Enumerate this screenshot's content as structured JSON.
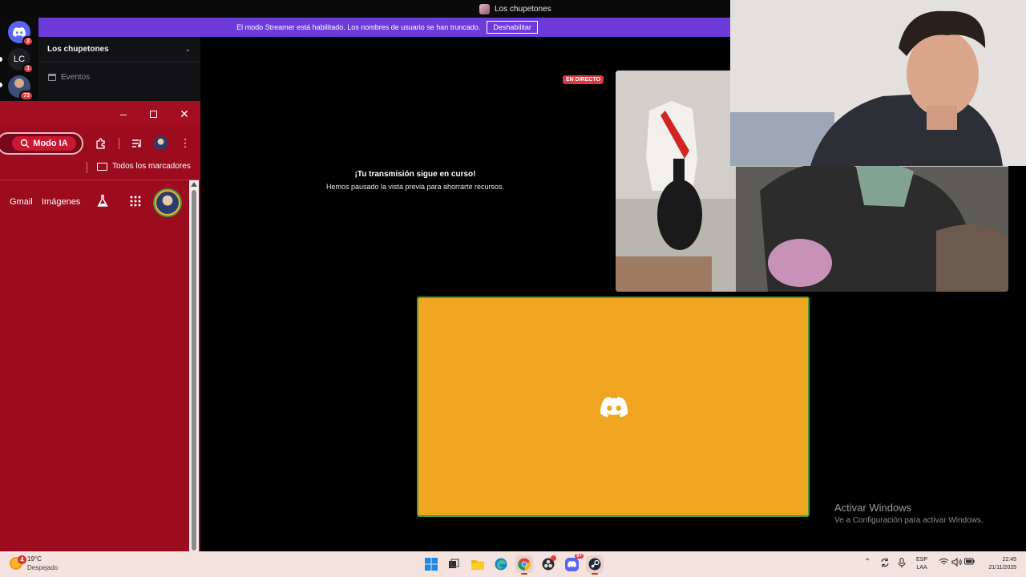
{
  "window": {
    "title": "Los chupetones"
  },
  "banner": {
    "message": "El modo Streamer está habilitado. Los nombres de usuario se han truncado.",
    "button_label": "Deshabilitar"
  },
  "servers": [
    {
      "label": "",
      "badge": "2"
    },
    {
      "label": "LC",
      "badge": "1"
    },
    {
      "label": "",
      "badge": "73"
    }
  ],
  "channel_list": {
    "server_name": "Los chupetones",
    "events_label": "Eventos"
  },
  "chrome": {
    "modo_ia_label": "Modo IA",
    "bookmarks_label": "Todos los marcadores",
    "links": {
      "gmail": "Gmail",
      "images": "Imágenes"
    }
  },
  "stream": {
    "live_badge": "EN DIRECTO",
    "paused_title": "¡Tu transmisión sigue en curso!",
    "paused_subtitle": "Hemos pausado la vista previa para ahorrarte recursos."
  },
  "activate_windows": {
    "title": "Activar Windows",
    "subtitle": "Ve a Configuración para activar Windows."
  },
  "taskbar": {
    "weather": {
      "temp": "19°C",
      "condition": "Despejado",
      "badge": "4"
    },
    "language": {
      "lang": "ESP",
      "layout": "LAA"
    },
    "clock": {
      "time": "22:45",
      "date": "21/11/2025"
    },
    "discord_badge": "9+",
    "colors": {
      "accent": "#c0392b",
      "bg": "#f3e2dd"
    }
  },
  "colors": {
    "discord_blurple": "#5865f2",
    "streamer_banner": "#6c3bd9",
    "chrome_red": "#9d0b1f",
    "tile_orange": "#f0a621",
    "live_red": "#d83a3f"
  }
}
